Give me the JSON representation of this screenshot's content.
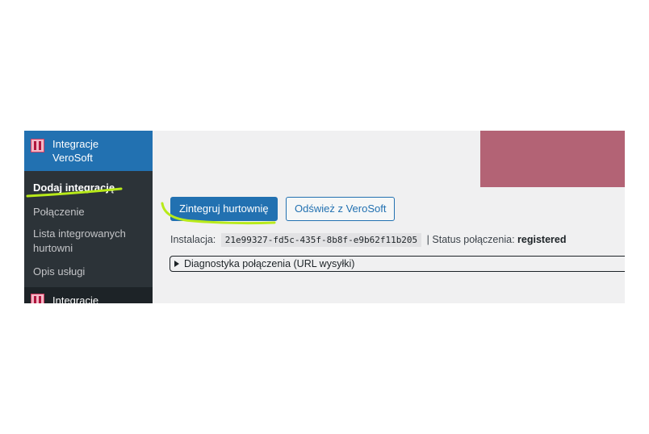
{
  "sidebar": {
    "active_menu": {
      "title": "Integracje VeroSoft",
      "icon": "verosoft-logo-icon"
    },
    "submenu": [
      {
        "label": "Dodaj integrację",
        "current": true
      },
      {
        "label": "Połączenie"
      },
      {
        "label": "Lista integrowanych hurtowni"
      },
      {
        "label": "Opis usługi"
      }
    ],
    "next_menu": {
      "title": "Integracje",
      "icon": "verosoft-logo-icon"
    }
  },
  "main": {
    "primary_button": "Zintegruj hurtownię",
    "secondary_button": "Odśwież z VeroSoft",
    "installation_label": "Instalacja:",
    "installation_id": "21e99327-fd5c-435f-8b8f-e9b62f11b205",
    "status_separator": "| Status połączenia:",
    "status_value": "registered",
    "diagnostics_summary": "Diagnostyka połączenia (URL wysyłki)"
  },
  "colors": {
    "admin_blue": "#2271b1",
    "sidebar_dark": "#1d2327",
    "highlight_annotation": "#b8ea1a",
    "redacted_block": "#b36375"
  }
}
